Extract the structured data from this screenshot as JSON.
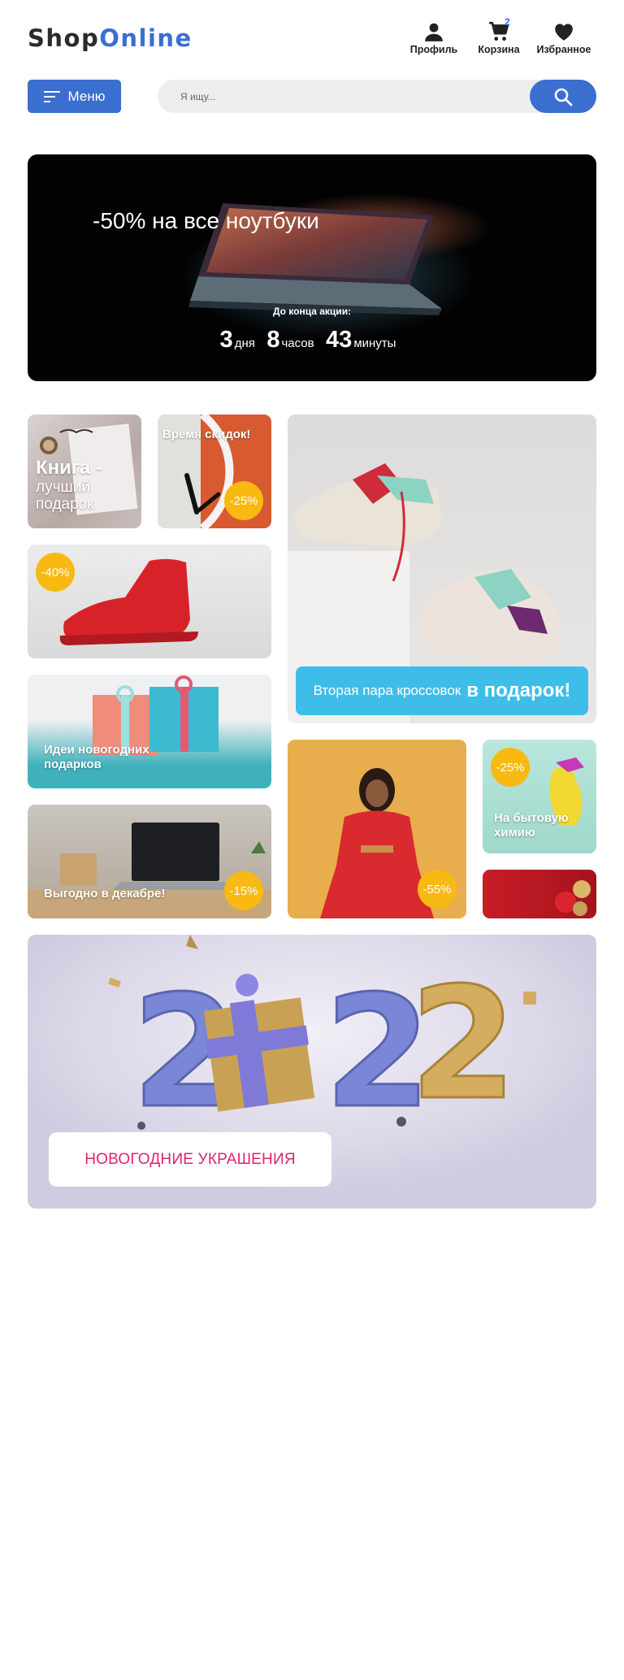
{
  "header": {
    "logo_part1": "Shop",
    "logo_part2": "Online",
    "nav": [
      {
        "label": "Профиль",
        "icon": "user-icon"
      },
      {
        "label": "Корзина",
        "icon": "cart-icon",
        "count": "2"
      },
      {
        "label": "Избранное",
        "icon": "heart-icon"
      }
    ]
  },
  "toolbar": {
    "menu_label": "Меню",
    "search_placeholder": "Я ищу..."
  },
  "hero": {
    "title": "-50% на все ноутбуки",
    "subtitle": "До конца акции:",
    "countdown": {
      "days": "3",
      "days_unit": "дня",
      "hours": "8",
      "hours_unit": "часов",
      "minutes": "43",
      "minutes_unit": "минуты"
    }
  },
  "tiles": {
    "book": {
      "title": "Книга -",
      "subtitle1": "лучший",
      "subtitle2": "подарок"
    },
    "clock": {
      "title": "Время скидок!",
      "badge": "-25%"
    },
    "sneaker": {
      "badge": "-40%"
    },
    "gifts": {
      "title1": "Идеи новогодних",
      "title2": "подарков"
    },
    "laptop": {
      "title": "Выгодно в декабре!",
      "badge": "-15%"
    },
    "shoes": {
      "text": "Вторая пара кроссовок",
      "text_bold": "в подарок!"
    },
    "dress": {
      "badge": "-55%"
    },
    "chem": {
      "badge": "-25%",
      "title1": "На бытовую",
      "title2": "химию"
    }
  },
  "newyear": {
    "button": "НОВОГОДНИЕ УКРАШЕНИЯ"
  },
  "colors": {
    "brand_blue": "#3a6fd0",
    "badge_yellow": "#f8b912",
    "banner_cyan": "#3fbde9",
    "accent_pink": "#e0246a"
  }
}
